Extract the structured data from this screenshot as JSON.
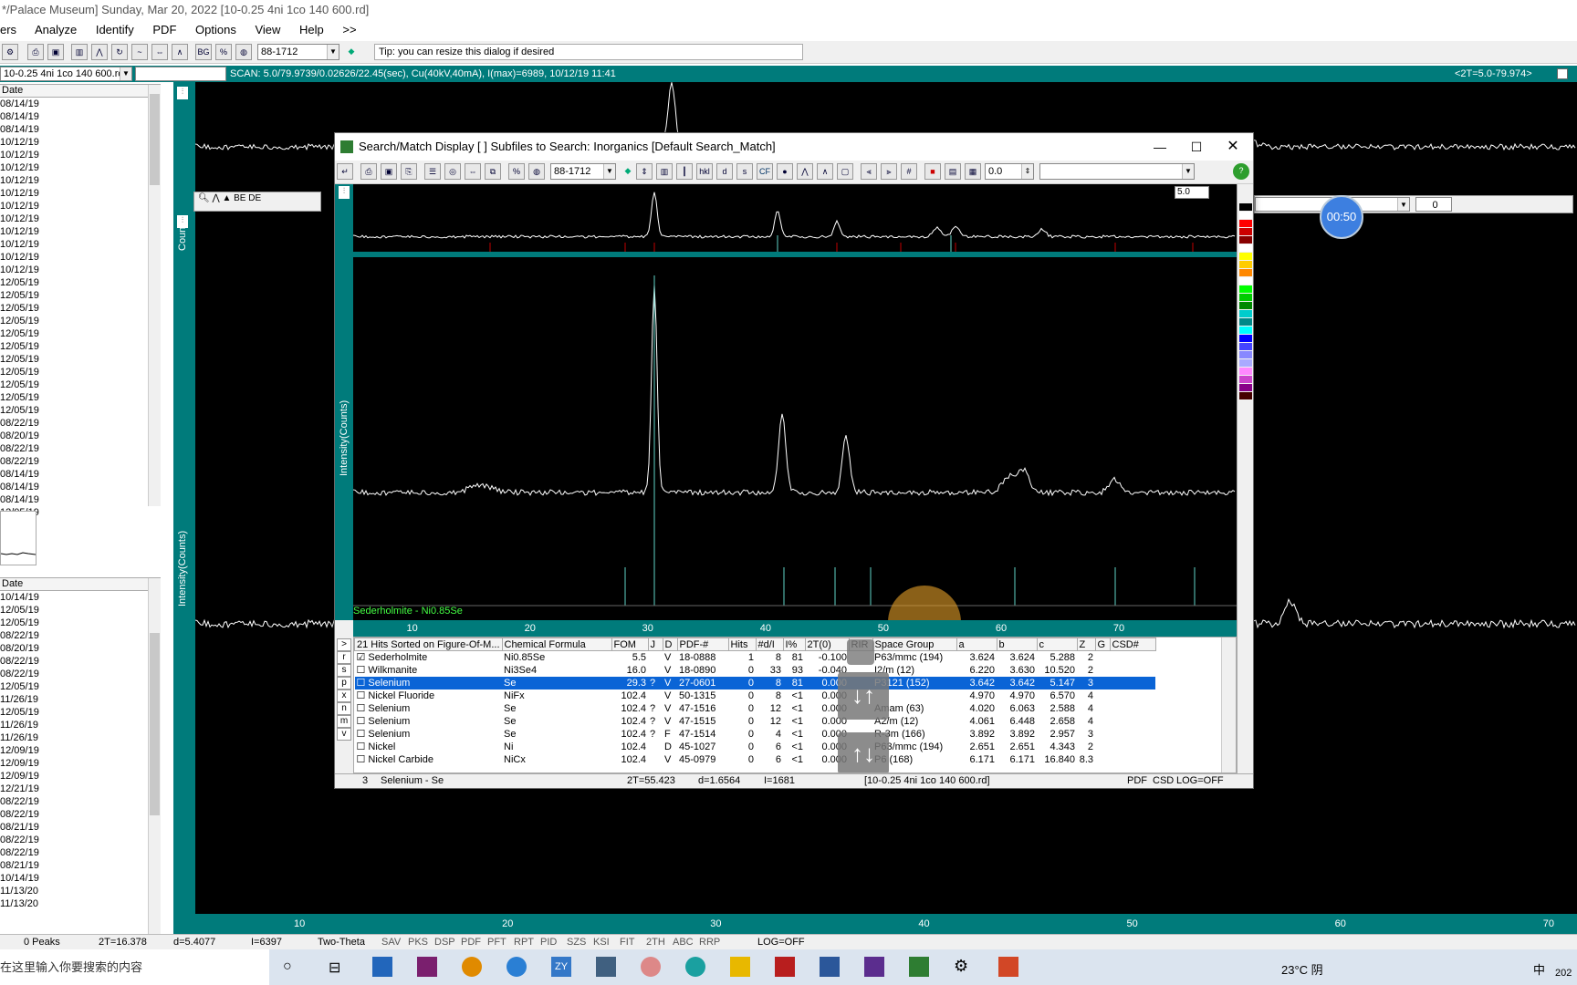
{
  "app": {
    "title": "*/Palace Museum] Sunday, Mar 20, 2022 [10-0.25 4ni 1co 140 600.rd]"
  },
  "menu": [
    "ers",
    "Analyze",
    "Identify",
    "PDF",
    "Options",
    "View",
    "Help",
    ">>"
  ],
  "toolbar": {
    "pdf_combo": "88-1712",
    "tip": "Tip: you can resize this dialog if desired"
  },
  "scanbar": {
    "file_combo": "10-0.25 4ni 1co 140 600.rd",
    "scan_text": "SCAN: 5.0/79.9739/0.02626/22.45(sec), Cu(40kV,40mA), I(max)=6989, 10/12/19 11:41",
    "range_text": "<2T=5.0-79.974>"
  },
  "left_pane": {
    "upper_header": "Date",
    "upper_dates": [
      "08/14/19",
      "08/14/19",
      "08/14/19",
      "10/12/19",
      "10/12/19",
      "10/12/19",
      "10/12/19",
      "10/12/19",
      "10/12/19",
      "10/12/19",
      "10/12/19",
      "10/12/19",
      "10/12/19",
      "10/12/19",
      "12/05/19",
      "12/05/19",
      "12/05/19",
      "12/05/19",
      "12/05/19",
      "12/05/19",
      "12/05/19",
      "12/05/19",
      "12/05/19",
      "12/05/19",
      "12/05/19",
      "08/22/19",
      "08/20/19",
      "08/22/19",
      "08/22/19",
      "08/14/19",
      "08/14/19",
      "08/14/19",
      "12/05/19"
    ],
    "lower_header": "Date",
    "lower_dates": [
      "10/14/19",
      "12/05/19",
      "12/05/19",
      "08/22/19",
      "08/20/19",
      "08/22/19",
      "08/22/19",
      "12/05/19",
      "11/26/19",
      "12/05/19",
      "11/26/19",
      "11/26/19",
      "12/09/19",
      "12/09/19",
      "12/09/19",
      "12/21/19",
      "08/22/19",
      "08/22/19",
      "08/21/19",
      "08/22/19",
      "08/22/19",
      "08/21/19",
      "10/14/19",
      "11/13/20",
      "11/13/20"
    ]
  },
  "main_plot": {
    "ylabel_top": "Counts",
    "ylabel_bottom": "Intensity(Counts)",
    "x_ticks": [
      "10",
      "20",
      "30",
      "40",
      "50",
      "60",
      "70"
    ],
    "timer": "00:50",
    "side_input": "0"
  },
  "statusbar": {
    "peaks": "0 Peaks",
    "two_theta": "2T=16.378",
    "d": "d=5.4077",
    "i": "I=6397",
    "mode": "Two-Theta",
    "buttons": [
      "SAV",
      "PKS",
      "DSP",
      "PDF",
      "PFT",
      "RPT",
      "PID",
      "SZS",
      "KSI",
      "FIT",
      "2TH",
      "ABC",
      "RRP"
    ],
    "log": "LOG=OFF"
  },
  "dialog": {
    "title": "Search/Match Display [ ] Subfiles to Search: Inorganics [Default Search_Match]",
    "pdf_combo": "88-1712",
    "num_field": "0.0",
    "top_field": "5.0",
    "ylabel": "Intensity(Counts)",
    "phase_label": "Sederholmite - Ni0.85Se",
    "x_ticks": [
      "10",
      "20",
      "30",
      "40",
      "50",
      "60",
      "70"
    ],
    "table_headers": [
      "21 Hits Sorted on Figure-Of-M...",
      "Chemical Formula",
      "FOM",
      "J",
      "D",
      "PDF-#",
      "Hits",
      "#d/I",
      "I%",
      "2T(0)",
      "RIR",
      "Space Group",
      "a",
      "b",
      "c",
      "Z",
      "G",
      "CSD#"
    ],
    "rows": [
      {
        "checked": true,
        "name": "Sederholmite",
        "formula": "Ni0.85Se",
        "fom": "5.5",
        "j": "",
        "d": "V",
        "pdf": "18-0888",
        "hits": "1",
        "di": "8",
        "ip": "81",
        "t0": "-0.100",
        "rir": "",
        "sg": "P63/mmc (194)",
        "a": "3.624",
        "b": "3.624",
        "c": "5.288",
        "z": "2"
      },
      {
        "checked": false,
        "name": "Wilkmanite",
        "formula": "Ni3Se4",
        "fom": "16.0",
        "j": "",
        "d": "V",
        "pdf": "18-0890",
        "hits": "0",
        "di": "33",
        "ip": "93",
        "t0": "-0.040",
        "rir": "",
        "sg": "I2/m (12)",
        "a": "6.220",
        "b": "3.630",
        "c": "10.520",
        "z": "2"
      },
      {
        "checked": false,
        "name": "Selenium",
        "formula": "Se",
        "fom": "29.3",
        "j": "?",
        "d": "V",
        "pdf": "27-0601",
        "hits": "0",
        "di": "8",
        "ip": "81",
        "t0": "0.000",
        "rir": "",
        "sg": "P3121 (152)",
        "a": "3.642",
        "b": "3.642",
        "c": "5.147",
        "z": "3"
      },
      {
        "checked": false,
        "name": "Nickel Fluoride",
        "formula": "NiFx",
        "fom": "102.4",
        "j": "",
        "d": "V",
        "pdf": "50-1315",
        "hits": "0",
        "di": "8",
        "ip": "<1",
        "t0": "0.000",
        "rir": "",
        "sg": "",
        "a": "4.970",
        "b": "4.970",
        "c": "6.570",
        "z": "4"
      },
      {
        "checked": false,
        "name": "Selenium",
        "formula": "Se",
        "fom": "102.4",
        "j": "?",
        "d": "V",
        "pdf": "47-1516",
        "hits": "0",
        "di": "12",
        "ip": "<1",
        "t0": "0.000",
        "rir": "",
        "sg": "Amam (63)",
        "a": "4.020",
        "b": "6.063",
        "c": "2.588",
        "z": "4"
      },
      {
        "checked": false,
        "name": "Selenium",
        "formula": "Se",
        "fom": "102.4",
        "j": "?",
        "d": "V",
        "pdf": "47-1515",
        "hits": "0",
        "di": "12",
        "ip": "<1",
        "t0": "0.000",
        "rir": "",
        "sg": "A2/m (12)",
        "a": "4.061",
        "b": "6.448",
        "c": "2.658",
        "z": "4"
      },
      {
        "checked": false,
        "name": "Selenium",
        "formula": "Se",
        "fom": "102.4",
        "j": "?",
        "d": "F",
        "pdf": "47-1514",
        "hits": "0",
        "di": "4",
        "ip": "<1",
        "t0": "0.000",
        "rir": "",
        "sg": "R-3m (166)",
        "a": "3.892",
        "b": "3.892",
        "c": "2.957",
        "z": "3"
      },
      {
        "checked": false,
        "name": "Nickel",
        "formula": "Ni",
        "fom": "102.4",
        "j": "",
        "d": "D",
        "pdf": "45-1027",
        "hits": "0",
        "di": "6",
        "ip": "<1",
        "t0": "0.000",
        "rir": "",
        "sg": "P63/mmc (194)",
        "a": "2.651",
        "b": "2.651",
        "c": "4.343",
        "z": "2"
      },
      {
        "checked": false,
        "name": "Nickel Carbide",
        "formula": "NiCx",
        "fom": "102.4",
        "j": "",
        "d": "V",
        "pdf": "45-0979",
        "hits": "0",
        "di": "6",
        "ip": "<1",
        "t0": "0.000",
        "rir": "",
        "sg": "P6 (168)",
        "a": "6.171",
        "b": "6.171",
        "c": "16.840",
        "z": "8.3"
      }
    ],
    "side_tabs": [
      ">",
      "r",
      "s",
      "p",
      "x",
      "n",
      "m",
      "v"
    ],
    "status": {
      "index": "3",
      "name": "Selenium - Se",
      "two_theta": "2T=55.423",
      "d": "d=1.6564",
      "i": "I=1681",
      "file": "[10-0.25 4ni 1co 140 600.rd]",
      "pdf": "PDF",
      "csd": "CSD",
      "log": "LOG=OFF"
    }
  },
  "taskbar": {
    "search_placeholder": "在这里输入你要搜索的内容",
    "weather": "23°C 阴",
    "ime": "中",
    "clock": "202"
  },
  "colors": {
    "teal": "#007b7b",
    "selected": "#0a64d6",
    "trace": "#ffffff",
    "stick": "#5fd3c8",
    "red_stick": "#c00000"
  }
}
